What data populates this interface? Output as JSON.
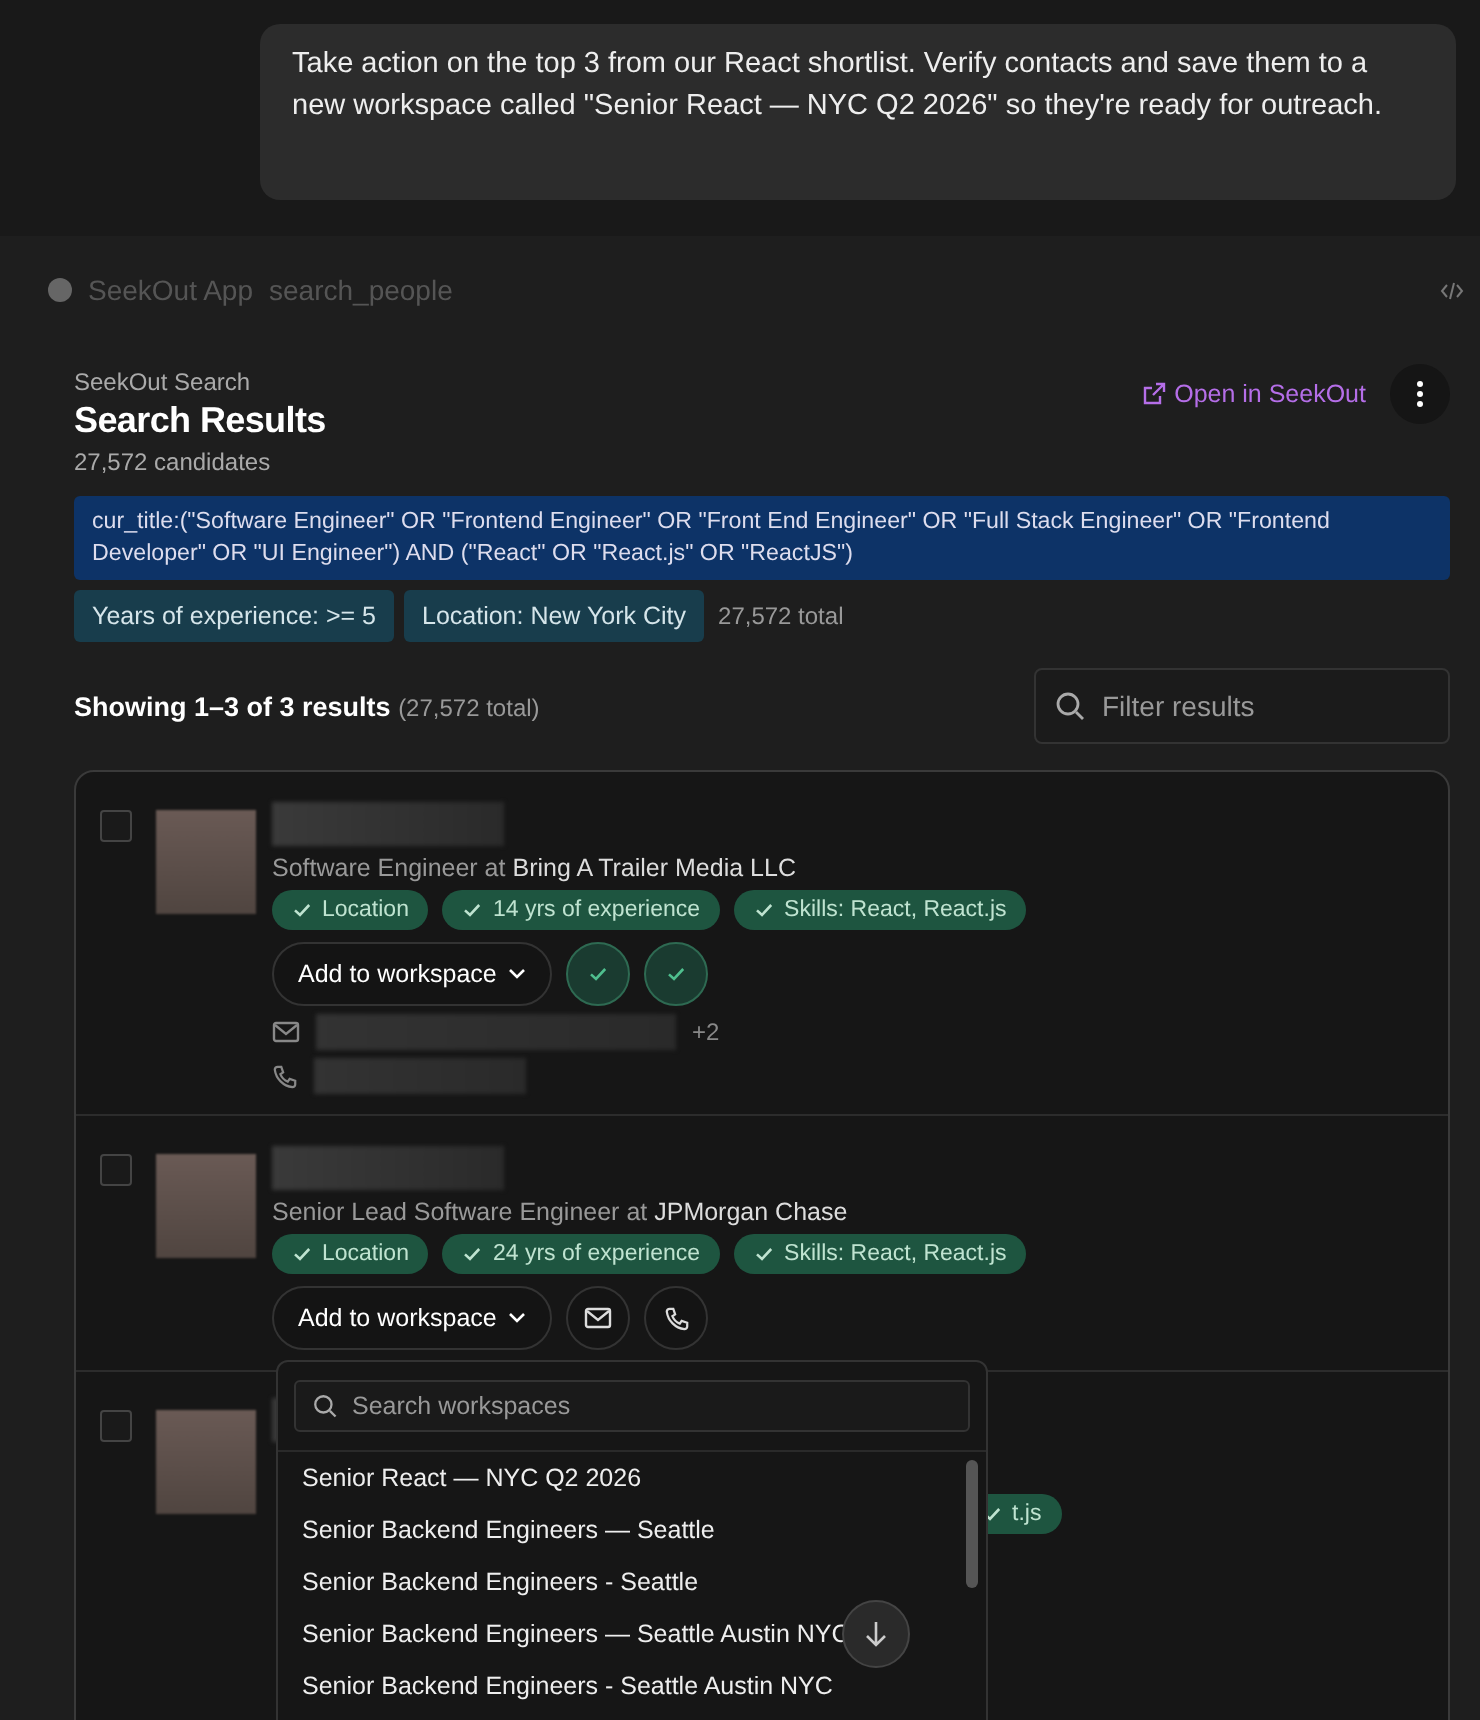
{
  "user_message": "Take action on the top 3 from our React shortlist. Verify contacts and save them to a new workspace called \"Senior React — NYC Q2 2026\" so they're ready for outreach.",
  "app_header": {
    "app_name": "SeekOut App",
    "tool_name": "search_people"
  },
  "search": {
    "subtitle": "SeekOut Search",
    "title": "Search Results",
    "count": "27,572 candidates",
    "open_link": "Open in SeekOut",
    "query": "cur_title:(\"Software Engineer\" OR \"Frontend Engineer\" OR \"Front End Engineer\" OR \"Full Stack Engineer\" OR \"Frontend Developer\" OR \"UI Engineer\") AND (\"React\" OR \"React.js\" OR \"ReactJS\")",
    "filters": [
      "Years of experience: >= 5",
      "Location: New York City"
    ],
    "total": "27,572 total"
  },
  "results_header": {
    "showing": "Showing 1–3 of 3 results",
    "total": "(27,572 total)",
    "filter_placeholder": "Filter results"
  },
  "candidates": [
    {
      "checked": false,
      "title": "Software Engineer at",
      "company": "Bring A Trailer Media LLC",
      "chips": [
        "Location",
        "14 yrs of experience",
        "Skills: React, React.js"
      ],
      "add_button": "Add to workspace",
      "contact_buttons": [
        {
          "kind": "verified"
        },
        {
          "kind": "verified"
        }
      ],
      "email_extra": "+2"
    },
    {
      "checked": false,
      "title": "Senior Lead Software Engineer at",
      "company": "JPMorgan Chase",
      "chips": [
        "Location",
        "24 yrs of experience",
        "Skills: React, React.js"
      ],
      "add_button": "Add to workspace",
      "contact_buttons": [
        {
          "kind": "email"
        },
        {
          "kind": "phone"
        }
      ]
    },
    {
      "checked": false,
      "chips": [
        "t.js"
      ]
    }
  ],
  "workspace_dropdown": {
    "placeholder": "Search workspaces",
    "items": [
      "Senior React — NYC Q2 2026",
      "Senior Backend Engineers — Seattle",
      "Senior Backend Engineers - Seattle",
      "Senior Backend Engineers — Seattle Austin NYC",
      "Senior Backend Engineers - Seattle Austin NYC"
    ]
  }
}
